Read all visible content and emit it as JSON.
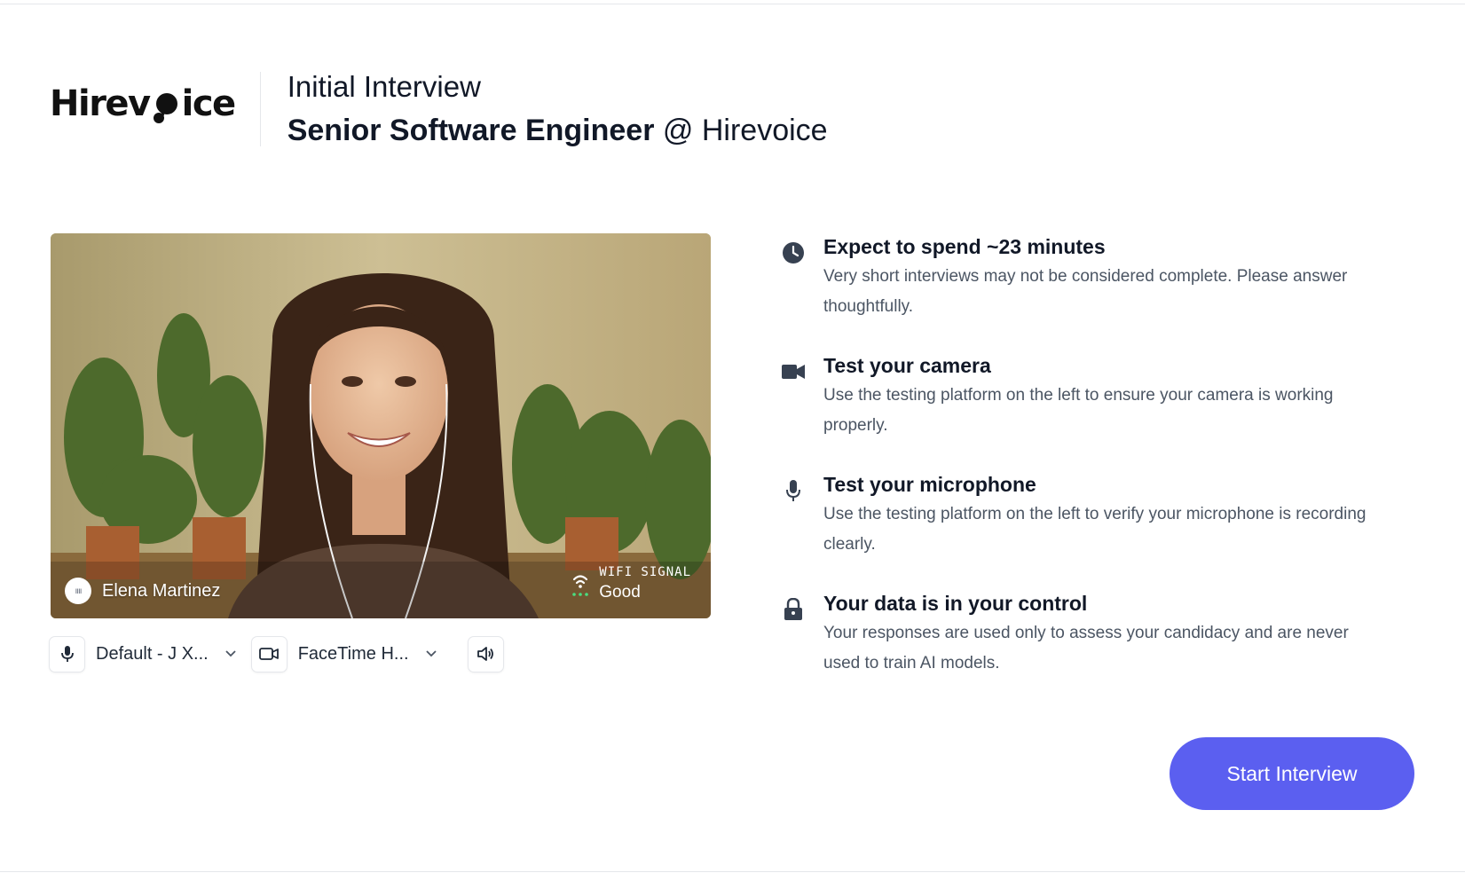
{
  "brand": {
    "logo_text_left": "Hirev",
    "logo_text_right": "ice"
  },
  "header": {
    "interview_type": "Initial Interview",
    "role": "Senior Software Engineer",
    "company_suffix": " @ Hirevoice"
  },
  "video": {
    "participant_name": "Elena Martinez",
    "audio_indicator": "ıııı",
    "wifi_label": "WIFI SIGNAL",
    "wifi_value": "Good"
  },
  "controls": {
    "microphone_device": "Default - J X...",
    "camera_device": "FaceTime H..."
  },
  "info": [
    {
      "icon": "clock-icon",
      "title": "Expect to spend ~23 minutes",
      "desc": "Very short interviews may not be considered complete. Please answer thoughtfully."
    },
    {
      "icon": "video-camera-icon",
      "title": "Test your camera",
      "desc": "Use the testing platform on the left to ensure your camera is working properly."
    },
    {
      "icon": "microphone-icon",
      "title": "Test your microphone",
      "desc": "Use the testing platform on the left to verify your microphone is recording clearly."
    },
    {
      "icon": "lock-icon",
      "title": "Your data is in your control",
      "desc": "Your responses are used only to assess your candidacy and are never used to train AI models."
    }
  ],
  "actions": {
    "start_label": "Start Interview"
  },
  "colors": {
    "accent": "#5b5ff0",
    "wifi_good": "#4ade80"
  }
}
